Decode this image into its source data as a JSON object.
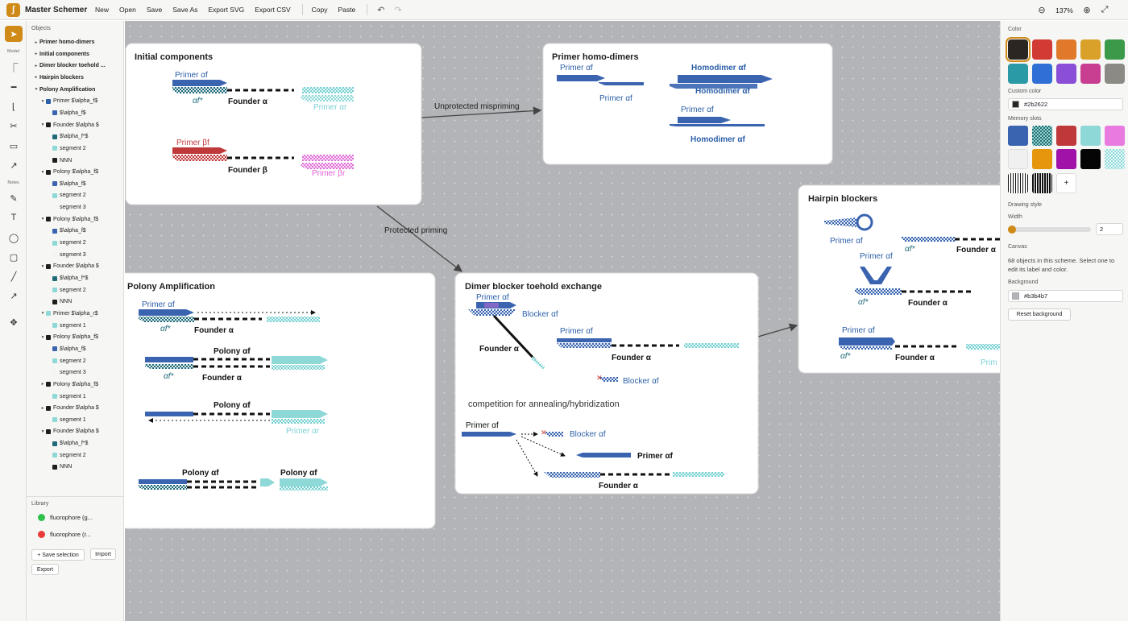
{
  "app": {
    "title": "Master Schemer"
  },
  "menu": {
    "items": [
      "New",
      "Open",
      "Save",
      "Save As",
      "Export SVG",
      "Export CSV"
    ],
    "edit_items": [
      "Copy",
      "Paste"
    ],
    "zoom": "137%"
  },
  "toolbar": {
    "groups": {
      "model": "Model",
      "notes": "Notes"
    }
  },
  "objects_panel": {
    "heading": "Objects",
    "tree": [
      {
        "label": "Primer homo-dimers",
        "level": 0,
        "arrow": "▸",
        "group": true
      },
      {
        "label": "Initial components",
        "level": 0,
        "arrow": "▸",
        "group": true
      },
      {
        "label": "Dimer blocker toehold ...",
        "level": 0,
        "arrow": "▸",
        "group": true
      },
      {
        "label": "Hairpin blockers",
        "level": 0,
        "arrow": "▸",
        "group": true
      },
      {
        "label": "Polony Amplification",
        "level": 0,
        "arrow": "▾",
        "group": true
      },
      {
        "label": "Primer $\\alpha_f$",
        "level": 1,
        "arrow": "▾",
        "color": "#2b5fa8"
      },
      {
        "label": "$\\alpha_f$",
        "level": 2,
        "color": "#3a64b0"
      },
      {
        "label": "Founder $\\alpha $",
        "level": 1,
        "arrow": "▾",
        "color": "#1e1e1e"
      },
      {
        "label": "$\\alpha_f*$",
        "level": 2,
        "color": "#1e6a78"
      },
      {
        "label": "segment 2",
        "level": 2,
        "color": "#8fd8d8"
      },
      {
        "label": "NNN",
        "level": 2,
        "color": "#1e1e1e"
      },
      {
        "label": "Polony $\\alpha_f$",
        "level": 1,
        "arrow": "▾",
        "color": "#1e1e1e"
      },
      {
        "label": "$\\alpha_f$",
        "level": 2,
        "color": "#3a64b0"
      },
      {
        "label": "segment 2",
        "level": 2,
        "color": "#8fd8d8"
      },
      {
        "label": "segment 3",
        "level": 2,
        "color": "#f4f4f4"
      },
      {
        "label": "Polony $\\alpha_f$",
        "level": 1,
        "arrow": "▾",
        "color": "#1e1e1e"
      },
      {
        "label": "$\\alpha_f$",
        "level": 2,
        "color": "#3a64b0"
      },
      {
        "label": "segment 2",
        "level": 2,
        "color": "#8fd8d8"
      },
      {
        "label": "segment 3",
        "level": 2,
        "color": "#f4f4f4"
      },
      {
        "label": "Founder $\\alpha $",
        "level": 1,
        "arrow": "▾",
        "color": "#1e1e1e"
      },
      {
        "label": "$\\alpha_f*$",
        "level": 2,
        "color": "#1e6a78"
      },
      {
        "label": "segment 2",
        "level": 2,
        "color": "#8fd8d8"
      },
      {
        "label": "NNN",
        "level": 2,
        "color": "#1e1e1e"
      },
      {
        "label": "Primer $\\alpha_r$",
        "level": 1,
        "arrow": "▾",
        "color": "#8fd8d8"
      },
      {
        "label": "segment 1",
        "level": 2,
        "color": "#8fd8d8"
      },
      {
        "label": "Polony $\\alpha_f$",
        "level": 1,
        "arrow": "▾",
        "color": "#1e1e1e"
      },
      {
        "label": "$\\alpha_f$",
        "level": 2,
        "color": "#3a64b0"
      },
      {
        "label": "segment 2",
        "level": 2,
        "color": "#8fd8d8"
      },
      {
        "label": "segment 3",
        "level": 2,
        "color": "#f4f4f4"
      },
      {
        "label": "Polony $\\alpha_f$",
        "level": 1,
        "arrow": "▸",
        "color": "#1e1e1e"
      },
      {
        "label": "segment 1",
        "level": 2,
        "color": "#8fd8d8"
      },
      {
        "label": "Founder $\\alpha $",
        "level": 1,
        "arrow": "▸",
        "color": "#1e1e1e"
      },
      {
        "label": "segment 1",
        "level": 2,
        "color": "#8fd8d8"
      },
      {
        "label": "Founder $\\alpha $",
        "level": 1,
        "arrow": "▾",
        "color": "#1e1e1e"
      },
      {
        "label": "$\\alpha_f*$",
        "level": 2,
        "color": "#1e6a78"
      },
      {
        "label": "segment 2",
        "level": 2,
        "color": "#8fd8d8"
      },
      {
        "label": "NNN",
        "level": 2,
        "color": "#1e1e1e"
      }
    ]
  },
  "library": {
    "heading": "Library",
    "items": [
      {
        "label": "fluorophore (g...",
        "color": "#2ec24a"
      },
      {
        "label": "fluorophore (r...",
        "color": "#e83a3a"
      }
    ],
    "save_selection": "+ Save selection",
    "import": "Import",
    "export": "Export"
  },
  "canvas": {
    "frames": {
      "initial": "Initial components",
      "homodimers": "Primer homo-dimers",
      "hairpin": "Hairpin blockers",
      "polony": "Polony Amplification",
      "dimer": "Dimer blocker toehold exchange"
    },
    "edges": {
      "unprotected": "Unprotected mispriming",
      "protected": "Protected priming"
    },
    "labels": {
      "primer_af": "Primer αf",
      "af_star": "αf*",
      "founder_a": "Founder α",
      "primer_ar": "Primer αr",
      "primer_bf": "Primer βf",
      "founder_b": "Founder β",
      "primer_br": "Primer βr",
      "homodimer_af": "Homodimer αf",
      "polony_af": "Polony αf",
      "blocker_af": "Blocker αf",
      "competition": "competition for annealing/hybridization"
    }
  },
  "properties": {
    "color_heading": "Color",
    "colors": [
      "#2b2622",
      "#d23a34",
      "#e07a2a",
      "#d9a12a",
      "#3a9a4a",
      "#2a9aa6",
      "#2f6fd6",
      "#8a4fd6",
      "#c83f92",
      "#8c8a85"
    ],
    "custom_color_heading": "Custom color",
    "custom_color_value": "#2b2622",
    "memory_heading": "Memory slots",
    "drawing_style_heading": "Drawing style",
    "width_label": "Width",
    "width_value": "2",
    "width_fraction": 0.05,
    "canvas_heading": "Canvas",
    "canvas_info": "68 objects in this scheme. Select one to edit its label and color.",
    "background_heading": "Background",
    "background_value": "#b3b4b7",
    "reset_background": "Reset background"
  }
}
